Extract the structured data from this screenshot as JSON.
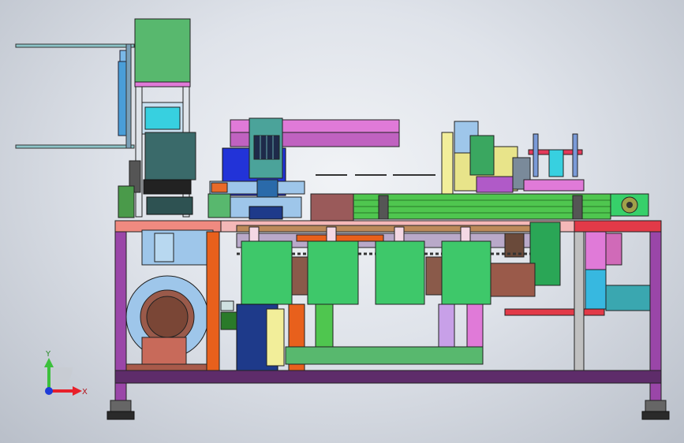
{
  "axes": {
    "x_label": "X",
    "y_label": "Y",
    "x_color": "#e8202a",
    "y_color": "#3cc03c",
    "z_color": "#1e3cd8"
  },
  "palette": {
    "frame_purple": "#9a46a8",
    "frame_dark": "#5e2c6a",
    "cabinet_green": "#3ec86a",
    "top_green": "#58b86e",
    "conveyor_green": "#4fc64f",
    "motor_blue": "#9ec6ea",
    "salmon": "#f08a80",
    "orange": "#e8601c",
    "magenta": "#e07ad8",
    "navy": "#1e3a8a",
    "blue": "#2233d8",
    "brown": "#9a5a4a",
    "teal": "#3aa7b0",
    "cream": "#f2ee9a"
  }
}
